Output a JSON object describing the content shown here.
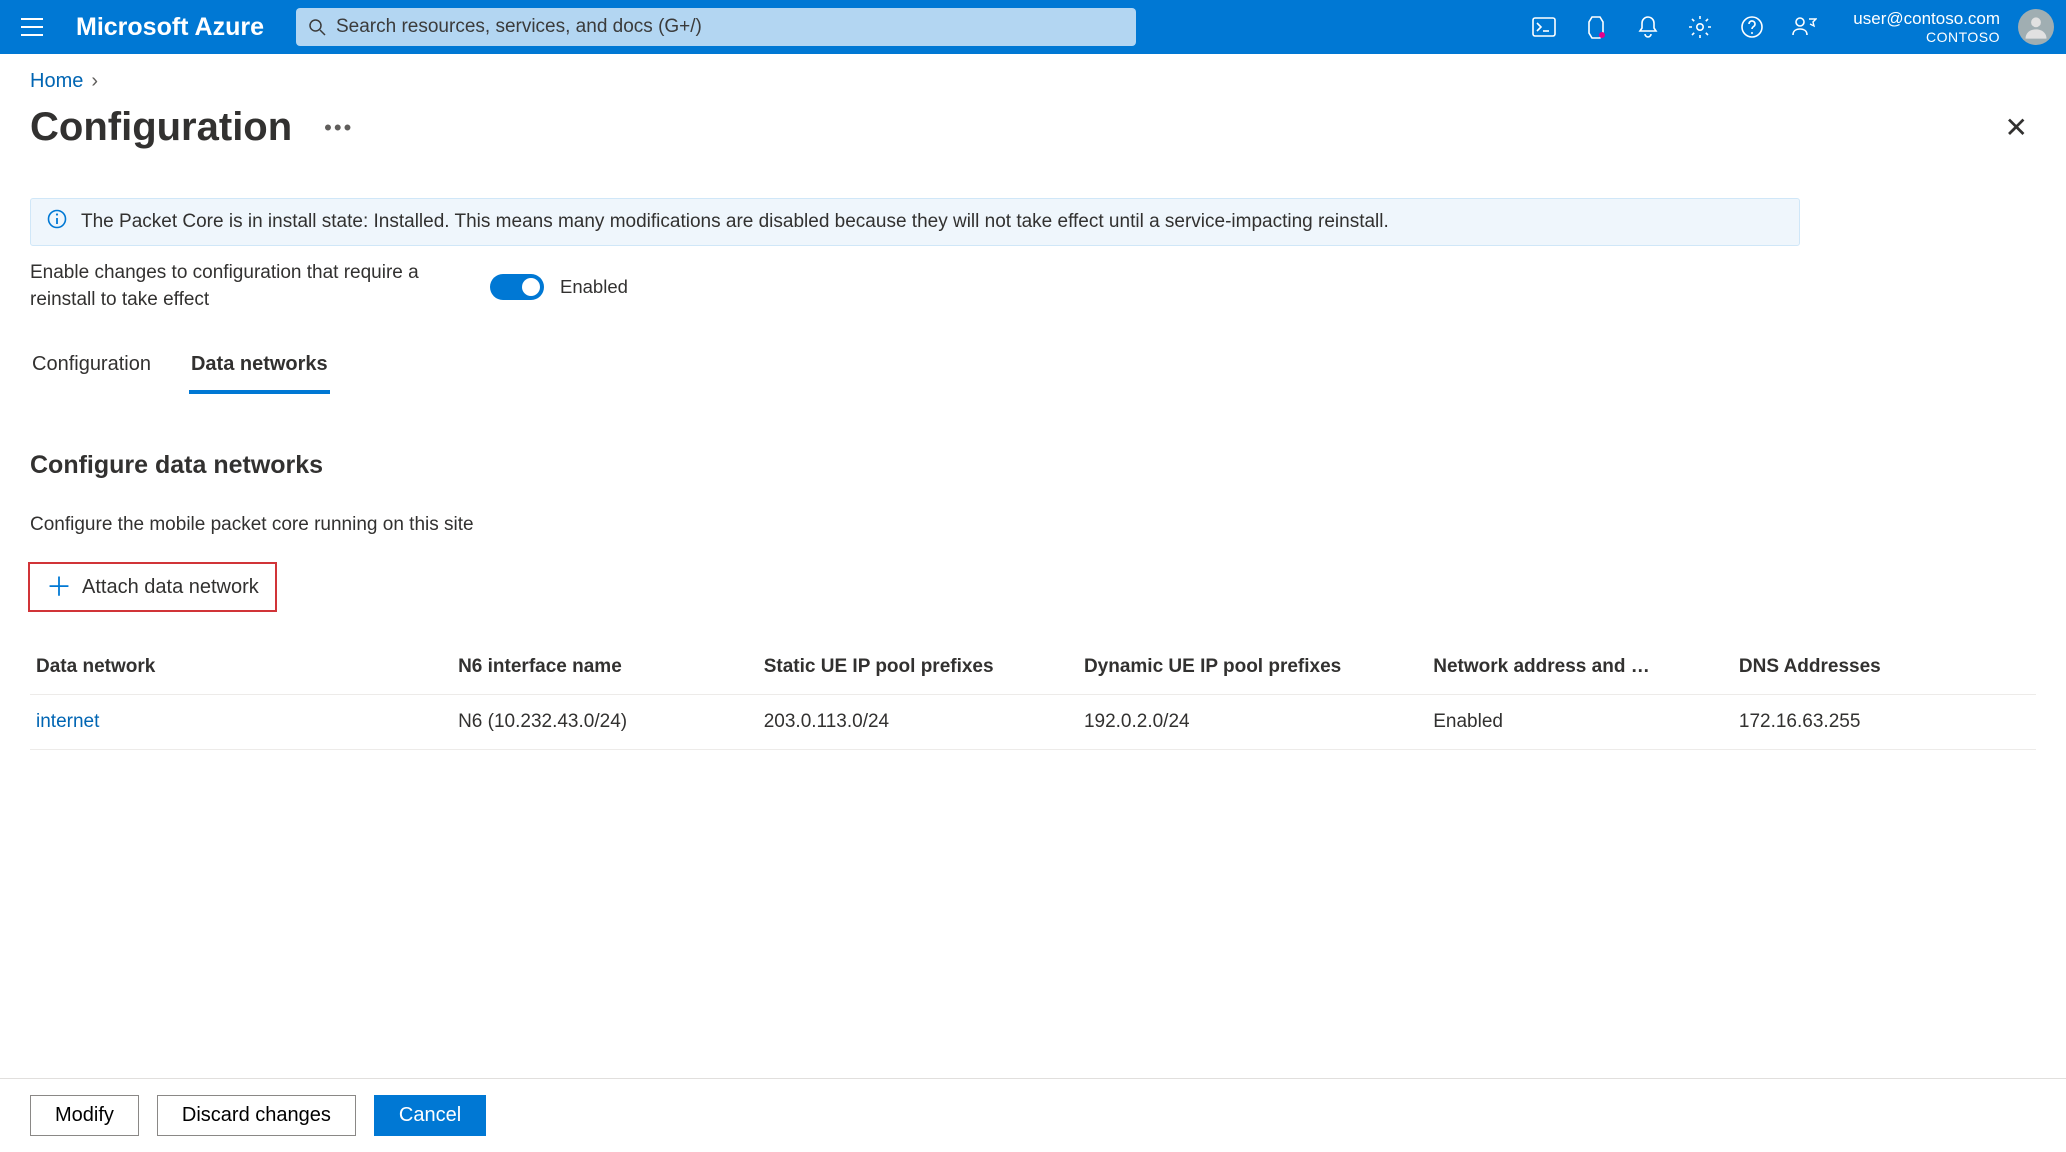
{
  "header": {
    "brand": "Microsoft Azure",
    "search_placeholder": "Search resources, services, and docs (G+/)",
    "user_email": "user@contoso.com",
    "tenant": "CONTOSO"
  },
  "breadcrumb": {
    "home": "Home"
  },
  "page": {
    "title": "Configuration",
    "info_text": "The Packet Core is in install state: Installed. This means many modifications are disabled because they will not take effect until a service-impacting reinstall."
  },
  "toggle": {
    "label": "Enable changes to configuration that require a reinstall to take effect",
    "state_label": "Enabled"
  },
  "tabs": {
    "config": "Configuration",
    "data_networks": "Data networks"
  },
  "section": {
    "title": "Configure data networks",
    "desc": "Configure the mobile packet core running on this site",
    "attach_label": "Attach data network"
  },
  "table": {
    "headers": {
      "dn": "Data network",
      "n6": "N6 interface name",
      "static": "Static UE IP pool prefixes",
      "dynamic": "Dynamic UE IP pool prefixes",
      "nap": "Network address and …",
      "dns": "DNS Addresses"
    },
    "rows": [
      {
        "dn": "internet",
        "n6": "N6 (10.232.43.0/24)",
        "static": "203.0.113.0/24",
        "dynamic": "192.0.2.0/24",
        "nap": "Enabled",
        "dns": "172.16.63.255"
      }
    ]
  },
  "footer": {
    "modify": "Modify",
    "discard": "Discard changes",
    "cancel": "Cancel"
  }
}
